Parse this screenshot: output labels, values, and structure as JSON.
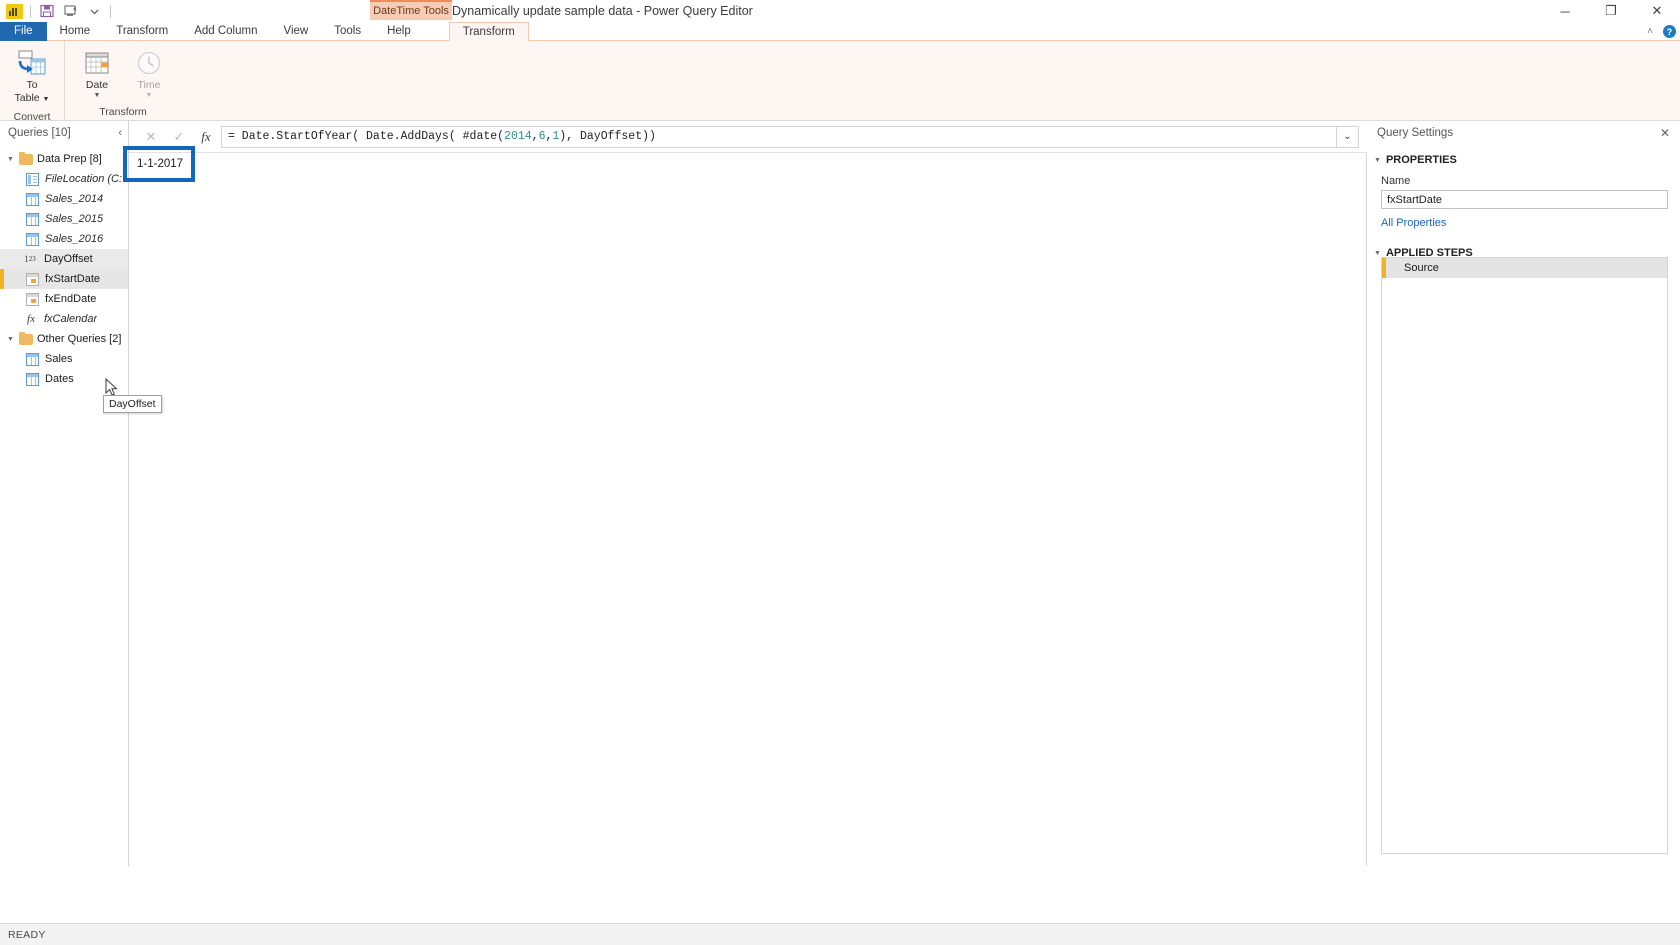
{
  "window": {
    "title": "Dynamically update sample data - Power Query Editor",
    "contextual_tab_group": "DateTime Tools",
    "quick_access": [
      "powerbi-logo-icon",
      "save-icon",
      "refresh-icon",
      "qat-dropdown-icon"
    ],
    "controls": {
      "minimize": "─",
      "maximize": "❐",
      "close": "✕",
      "collapse_ribbon": "˄",
      "help": "?"
    }
  },
  "ribbon": {
    "tabs": [
      {
        "label": "File",
        "id": "file"
      },
      {
        "label": "Home",
        "id": "home"
      },
      {
        "label": "Transform",
        "id": "transform"
      },
      {
        "label": "Add Column",
        "id": "add-column"
      },
      {
        "label": "View",
        "id": "view"
      },
      {
        "label": "Tools",
        "id": "tools"
      },
      {
        "label": "Help",
        "id": "help"
      },
      {
        "label": "Transform",
        "id": "ctx-transform"
      }
    ],
    "active_tab": "Transform",
    "groups": [
      {
        "label": "Convert",
        "buttons": [
          {
            "label_line1": "To",
            "label_line2": "Table",
            "icon": "to-table-icon",
            "has_caret": true,
            "disabled": false
          }
        ]
      },
      {
        "label": "Transform",
        "buttons": [
          {
            "label_line1": "Date",
            "label_line2": "",
            "icon": "calendar-icon",
            "has_caret": true,
            "disabled": false
          },
          {
            "label_line1": "Time",
            "label_line2": "",
            "icon": "clock-icon",
            "has_caret": true,
            "disabled": true
          }
        ]
      }
    ]
  },
  "queries_pane": {
    "header": "Queries [10]",
    "collapse_icon": "‹",
    "groups": [
      {
        "label": "Data Prep [8]",
        "expanded": true,
        "items": [
          {
            "label": "FileLocation (C:\\...",
            "icon": "record-icon",
            "italic": true,
            "state": "normal"
          },
          {
            "label": "Sales_2014",
            "icon": "table-icon",
            "italic": true,
            "state": "normal"
          },
          {
            "label": "Sales_2015",
            "icon": "table-icon",
            "italic": true,
            "state": "normal"
          },
          {
            "label": "Sales_2016",
            "icon": "table-icon",
            "italic": true,
            "state": "normal"
          },
          {
            "label": "DayOffset",
            "icon": "number-type-icon",
            "italic": false,
            "state": "hovered"
          },
          {
            "label": "fxStartDate",
            "icon": "fx-table-icon",
            "italic": false,
            "state": "selected"
          },
          {
            "label": "fxEndDate",
            "icon": "fx-table-icon",
            "italic": false,
            "state": "normal"
          },
          {
            "label": "fxCalendar",
            "icon": "fx-icon",
            "italic": true,
            "state": "normal"
          }
        ]
      },
      {
        "label": "Other Queries [2]",
        "expanded": true,
        "items": [
          {
            "label": "Sales",
            "icon": "table-icon",
            "italic": false,
            "state": "normal"
          },
          {
            "label": "Dates",
            "icon": "table-icon",
            "italic": false,
            "state": "normal"
          }
        ]
      }
    ],
    "tooltip": "DayOffset"
  },
  "formula_bar": {
    "cancel_icon": "✕",
    "accept_icon": "✓",
    "fx_icon": "fx",
    "prefix": "= Date.StartOfYear( Date.AddDays( #date(",
    "arg_year": "2014",
    "mid": ", ",
    "arg_month": "6",
    "comma": ",",
    "arg_day": "1",
    "suffix": "), DayOffset))",
    "full_text": "= Date.StartOfYear( Date.AddDays( #date(2014, 6,1), DayOffset))",
    "expand_icon": "⌄"
  },
  "data_preview": {
    "value": "1-1-2017",
    "highlight_color": "#1266bd"
  },
  "query_settings": {
    "header": "Query Settings",
    "close_icon": "✕",
    "properties_section": "PROPERTIES",
    "name_label": "Name",
    "name_value": "fxStartDate",
    "all_properties_link": "All Properties",
    "applied_steps_section": "APPLIED STEPS",
    "steps": [
      {
        "label": "Source",
        "selected": true
      }
    ]
  },
  "status_bar": {
    "text": "READY"
  },
  "colors": {
    "file_tab": "#2068b0",
    "contextual_accent": "#ef8a5c",
    "contextual_bg": "#f7ccb4",
    "selection_marker": "#f0b323",
    "link": "#1866b8",
    "highlight": "#1266bd"
  }
}
